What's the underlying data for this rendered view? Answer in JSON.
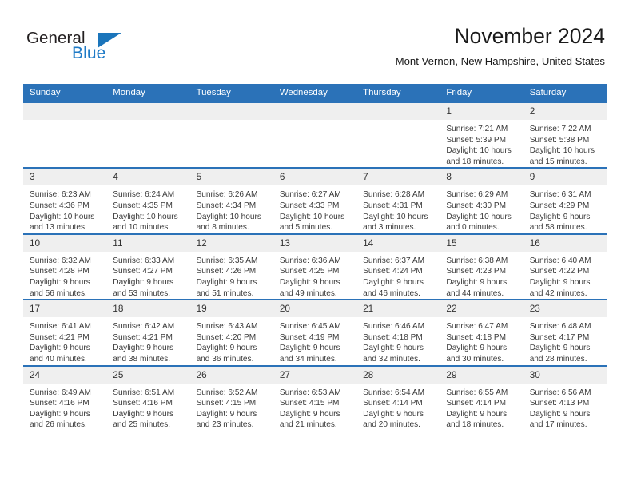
{
  "brand": {
    "name_part1": "General",
    "name_part2": "Blue",
    "logo_icon": "triangle-flag-icon",
    "accent_color": "#1b75bb"
  },
  "header": {
    "title": "November 2024",
    "location": "Mont Vernon, New Hampshire, United States"
  },
  "theme": {
    "header_bar_color": "#2b72b8",
    "day_band_color": "#efefef",
    "row_border_color": "#2b72b8",
    "text_color": "#3a3a3a"
  },
  "calendar": {
    "weekday_headers": [
      "Sunday",
      "Monday",
      "Tuesday",
      "Wednesday",
      "Thursday",
      "Friday",
      "Saturday"
    ],
    "weeks": [
      [
        {
          "day": "",
          "empty": true,
          "sunrise": "",
          "sunset": "",
          "daylight": ""
        },
        {
          "day": "",
          "empty": true,
          "sunrise": "",
          "sunset": "",
          "daylight": ""
        },
        {
          "day": "",
          "empty": true,
          "sunrise": "",
          "sunset": "",
          "daylight": ""
        },
        {
          "day": "",
          "empty": true,
          "sunrise": "",
          "sunset": "",
          "daylight": ""
        },
        {
          "day": "",
          "empty": true,
          "sunrise": "",
          "sunset": "",
          "daylight": ""
        },
        {
          "day": "1",
          "empty": false,
          "sunrise": "Sunrise: 7:21 AM",
          "sunset": "Sunset: 5:39 PM",
          "daylight": "Daylight: 10 hours and 18 minutes."
        },
        {
          "day": "2",
          "empty": false,
          "sunrise": "Sunrise: 7:22 AM",
          "sunset": "Sunset: 5:38 PM",
          "daylight": "Daylight: 10 hours and 15 minutes."
        }
      ],
      [
        {
          "day": "3",
          "empty": false,
          "sunrise": "Sunrise: 6:23 AM",
          "sunset": "Sunset: 4:36 PM",
          "daylight": "Daylight: 10 hours and 13 minutes."
        },
        {
          "day": "4",
          "empty": false,
          "sunrise": "Sunrise: 6:24 AM",
          "sunset": "Sunset: 4:35 PM",
          "daylight": "Daylight: 10 hours and 10 minutes."
        },
        {
          "day": "5",
          "empty": false,
          "sunrise": "Sunrise: 6:26 AM",
          "sunset": "Sunset: 4:34 PM",
          "daylight": "Daylight: 10 hours and 8 minutes."
        },
        {
          "day": "6",
          "empty": false,
          "sunrise": "Sunrise: 6:27 AM",
          "sunset": "Sunset: 4:33 PM",
          "daylight": "Daylight: 10 hours and 5 minutes."
        },
        {
          "day": "7",
          "empty": false,
          "sunrise": "Sunrise: 6:28 AM",
          "sunset": "Sunset: 4:31 PM",
          "daylight": "Daylight: 10 hours and 3 minutes."
        },
        {
          "day": "8",
          "empty": false,
          "sunrise": "Sunrise: 6:29 AM",
          "sunset": "Sunset: 4:30 PM",
          "daylight": "Daylight: 10 hours and 0 minutes."
        },
        {
          "day": "9",
          "empty": false,
          "sunrise": "Sunrise: 6:31 AM",
          "sunset": "Sunset: 4:29 PM",
          "daylight": "Daylight: 9 hours and 58 minutes."
        }
      ],
      [
        {
          "day": "10",
          "empty": false,
          "sunrise": "Sunrise: 6:32 AM",
          "sunset": "Sunset: 4:28 PM",
          "daylight": "Daylight: 9 hours and 56 minutes."
        },
        {
          "day": "11",
          "empty": false,
          "sunrise": "Sunrise: 6:33 AM",
          "sunset": "Sunset: 4:27 PM",
          "daylight": "Daylight: 9 hours and 53 minutes."
        },
        {
          "day": "12",
          "empty": false,
          "sunrise": "Sunrise: 6:35 AM",
          "sunset": "Sunset: 4:26 PM",
          "daylight": "Daylight: 9 hours and 51 minutes."
        },
        {
          "day": "13",
          "empty": false,
          "sunrise": "Sunrise: 6:36 AM",
          "sunset": "Sunset: 4:25 PM",
          "daylight": "Daylight: 9 hours and 49 minutes."
        },
        {
          "day": "14",
          "empty": false,
          "sunrise": "Sunrise: 6:37 AM",
          "sunset": "Sunset: 4:24 PM",
          "daylight": "Daylight: 9 hours and 46 minutes."
        },
        {
          "day": "15",
          "empty": false,
          "sunrise": "Sunrise: 6:38 AM",
          "sunset": "Sunset: 4:23 PM",
          "daylight": "Daylight: 9 hours and 44 minutes."
        },
        {
          "day": "16",
          "empty": false,
          "sunrise": "Sunrise: 6:40 AM",
          "sunset": "Sunset: 4:22 PM",
          "daylight": "Daylight: 9 hours and 42 minutes."
        }
      ],
      [
        {
          "day": "17",
          "empty": false,
          "sunrise": "Sunrise: 6:41 AM",
          "sunset": "Sunset: 4:21 PM",
          "daylight": "Daylight: 9 hours and 40 minutes."
        },
        {
          "day": "18",
          "empty": false,
          "sunrise": "Sunrise: 6:42 AM",
          "sunset": "Sunset: 4:21 PM",
          "daylight": "Daylight: 9 hours and 38 minutes."
        },
        {
          "day": "19",
          "empty": false,
          "sunrise": "Sunrise: 6:43 AM",
          "sunset": "Sunset: 4:20 PM",
          "daylight": "Daylight: 9 hours and 36 minutes."
        },
        {
          "day": "20",
          "empty": false,
          "sunrise": "Sunrise: 6:45 AM",
          "sunset": "Sunset: 4:19 PM",
          "daylight": "Daylight: 9 hours and 34 minutes."
        },
        {
          "day": "21",
          "empty": false,
          "sunrise": "Sunrise: 6:46 AM",
          "sunset": "Sunset: 4:18 PM",
          "daylight": "Daylight: 9 hours and 32 minutes."
        },
        {
          "day": "22",
          "empty": false,
          "sunrise": "Sunrise: 6:47 AM",
          "sunset": "Sunset: 4:18 PM",
          "daylight": "Daylight: 9 hours and 30 minutes."
        },
        {
          "day": "23",
          "empty": false,
          "sunrise": "Sunrise: 6:48 AM",
          "sunset": "Sunset: 4:17 PM",
          "daylight": "Daylight: 9 hours and 28 minutes."
        }
      ],
      [
        {
          "day": "24",
          "empty": false,
          "sunrise": "Sunrise: 6:49 AM",
          "sunset": "Sunset: 4:16 PM",
          "daylight": "Daylight: 9 hours and 26 minutes."
        },
        {
          "day": "25",
          "empty": false,
          "sunrise": "Sunrise: 6:51 AM",
          "sunset": "Sunset: 4:16 PM",
          "daylight": "Daylight: 9 hours and 25 minutes."
        },
        {
          "day": "26",
          "empty": false,
          "sunrise": "Sunrise: 6:52 AM",
          "sunset": "Sunset: 4:15 PM",
          "daylight": "Daylight: 9 hours and 23 minutes."
        },
        {
          "day": "27",
          "empty": false,
          "sunrise": "Sunrise: 6:53 AM",
          "sunset": "Sunset: 4:15 PM",
          "daylight": "Daylight: 9 hours and 21 minutes."
        },
        {
          "day": "28",
          "empty": false,
          "sunrise": "Sunrise: 6:54 AM",
          "sunset": "Sunset: 4:14 PM",
          "daylight": "Daylight: 9 hours and 20 minutes."
        },
        {
          "day": "29",
          "empty": false,
          "sunrise": "Sunrise: 6:55 AM",
          "sunset": "Sunset: 4:14 PM",
          "daylight": "Daylight: 9 hours and 18 minutes."
        },
        {
          "day": "30",
          "empty": false,
          "sunrise": "Sunrise: 6:56 AM",
          "sunset": "Sunset: 4:13 PM",
          "daylight": "Daylight: 9 hours and 17 minutes."
        }
      ]
    ]
  }
}
